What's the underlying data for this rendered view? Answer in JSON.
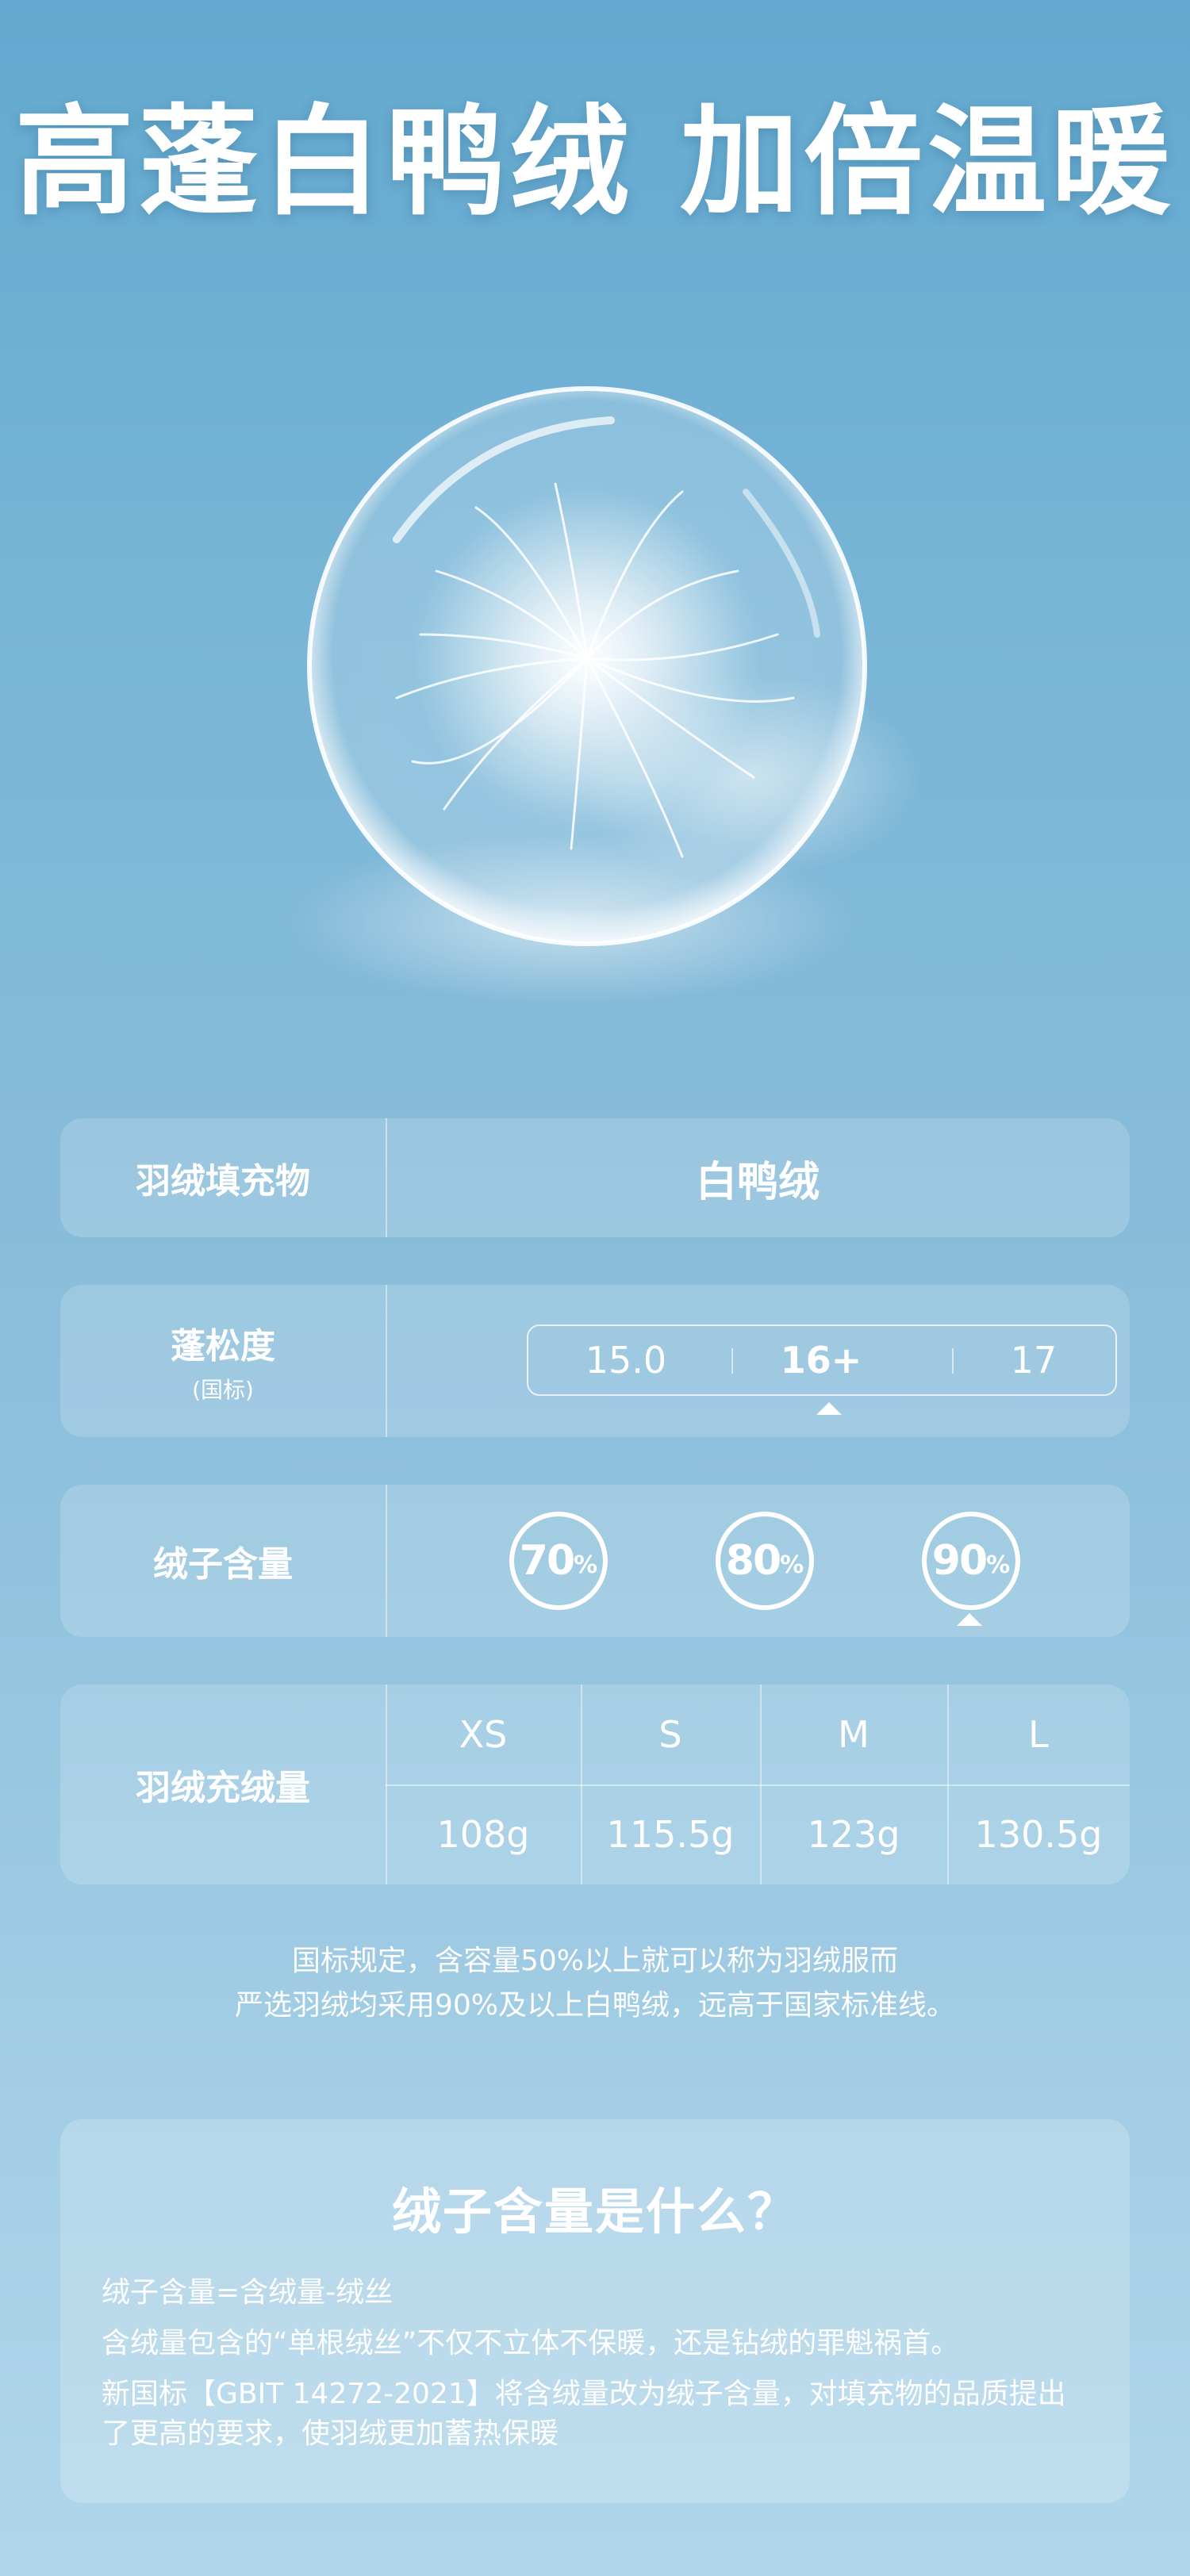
{
  "title": "高蓬白鸭绒 加倍温暖",
  "rows": {
    "filling": {
      "label": "羽绒填充物",
      "value": "白鸭绒"
    },
    "loft": {
      "label": "蓬松度",
      "sublabel": "(国标)",
      "options": [
        "15.0",
        "16+",
        "17"
      ],
      "selected": "16+"
    },
    "down_content": {
      "label": "绒子含量",
      "options": [
        {
          "value": "70",
          "unit": "%"
        },
        {
          "value": "80",
          "unit": "%"
        },
        {
          "value": "90",
          "unit": "%"
        }
      ],
      "selected": "90"
    },
    "fill_weight": {
      "label": "羽绒充绒量",
      "sizes": [
        "XS",
        "S",
        "M",
        "L"
      ],
      "weights": [
        "108g",
        "115.5g",
        "123g",
        "130.5g"
      ]
    }
  },
  "note": {
    "line1": "国标规定，含容量50%以上就可以称为羽绒服而",
    "line2": "严选羽绒均采用90%及以上白鸭绒，远高于国家标准线。"
  },
  "faq": {
    "title": "绒子含量是什么？",
    "p1": "绒子含量=含绒量-绒丝",
    "p2": "含绒量包含的“单根绒丝”不仅不立体不保暖，还是钻绒的罪魁祸首。",
    "p3": "新国标【GBIT 14272-2021】将含绒量改为绒子含量，对填充物的品质提出了更高的要求，使羽绒更加蓄热保暖"
  },
  "colors": {
    "background": "#7fb8d8",
    "text": "#ffffff"
  },
  "icons": {
    "hero": "down-feather-orb-icon",
    "pointer": "triangle-up-icon"
  }
}
